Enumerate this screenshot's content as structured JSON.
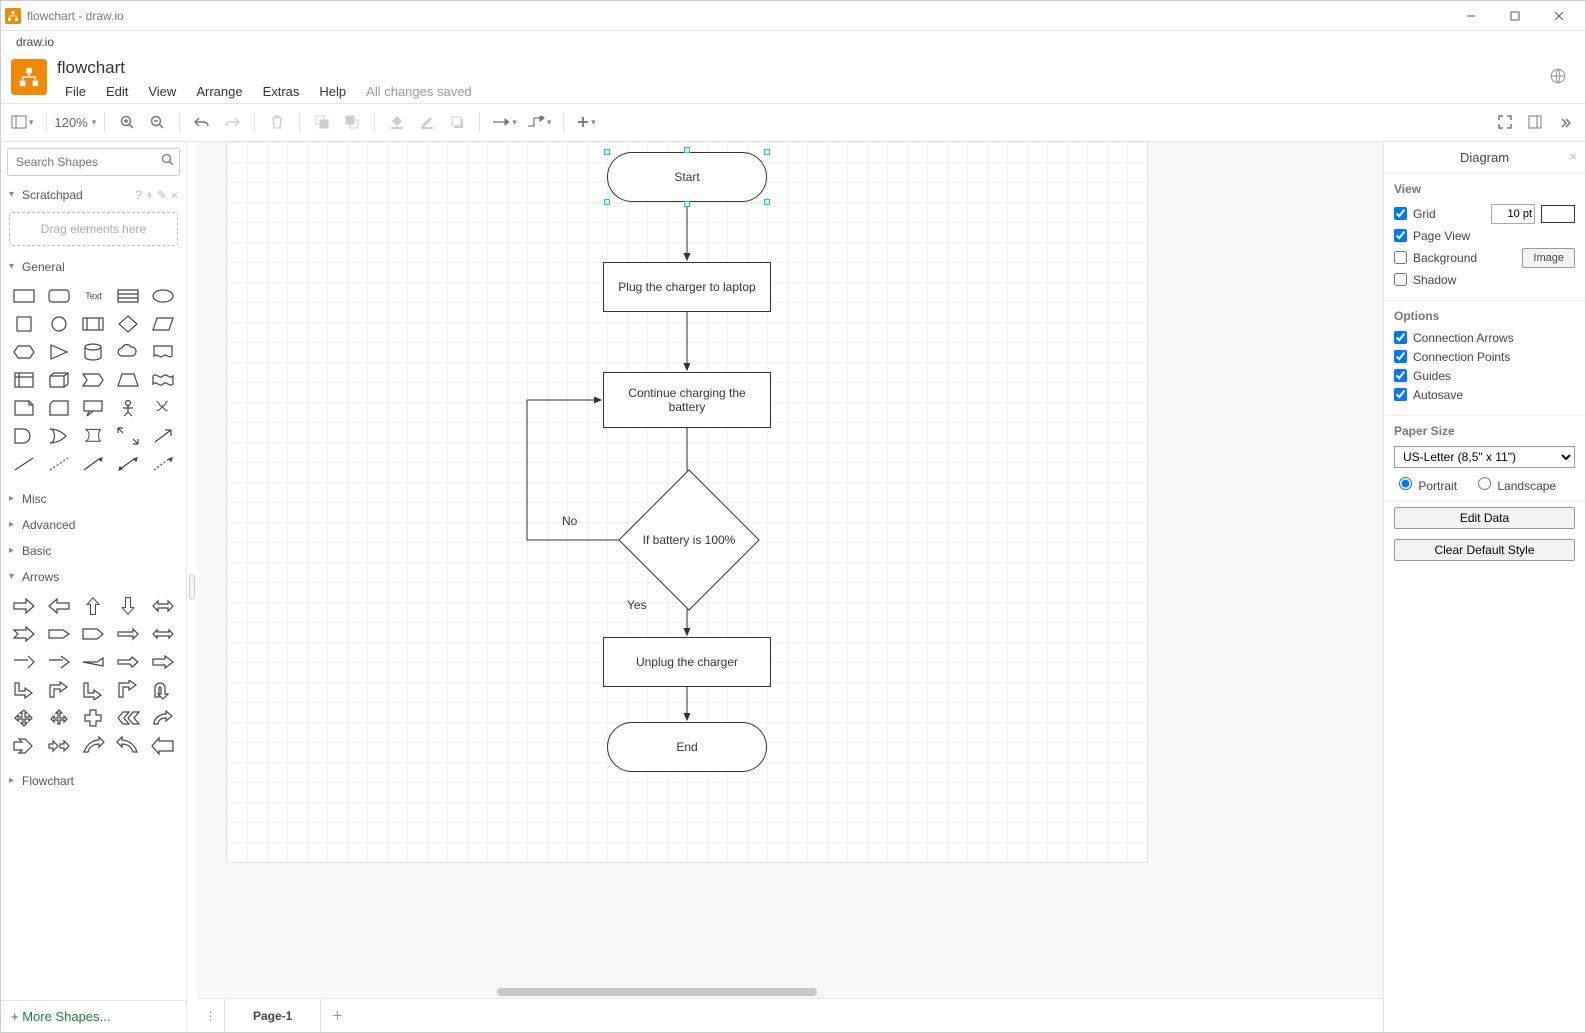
{
  "window": {
    "title": "flowchart - draw.io"
  },
  "app_tab": "draw.io",
  "doc": {
    "title": "flowchart"
  },
  "menus": {
    "file": "File",
    "edit": "Edit",
    "view": "View",
    "arrange": "Arrange",
    "extras": "Extras",
    "help": "Help",
    "status": "All changes saved"
  },
  "toolbar": {
    "zoom": "120%"
  },
  "sidebar": {
    "search_placeholder": "Search Shapes",
    "scratchpad": "Scratchpad",
    "scratchpad_hint": "Drag elements here",
    "sections": {
      "general": "General",
      "misc": "Misc",
      "advanced": "Advanced",
      "basic": "Basic",
      "arrows": "Arrows",
      "flowchart": "Flowchart"
    },
    "more": "+ More Shapes..."
  },
  "flow": {
    "start": "Start",
    "plug": "Plug the charger to laptop",
    "charge": "Continue charging the battery",
    "decision": "If battery is 100%",
    "no": "No",
    "yes": "Yes",
    "unplug": "Unplug the charger",
    "end": "End"
  },
  "pagetabs": {
    "page1": "Page-1"
  },
  "rightpanel": {
    "title": "Diagram",
    "view_h": "View",
    "grid": "Grid",
    "grid_value": "10 pt",
    "pageview": "Page View",
    "background": "Background",
    "image_btn": "Image",
    "shadow": "Shadow",
    "options_h": "Options",
    "conn_arrows": "Connection Arrows",
    "conn_points": "Connection Points",
    "guides": "Guides",
    "autosave": "Autosave",
    "paper_h": "Paper Size",
    "paper_value": "US-Letter (8,5\" x 11\")",
    "portrait": "Portrait",
    "landscape": "Landscape",
    "edit_data": "Edit Data",
    "clear_style": "Clear Default Style"
  }
}
